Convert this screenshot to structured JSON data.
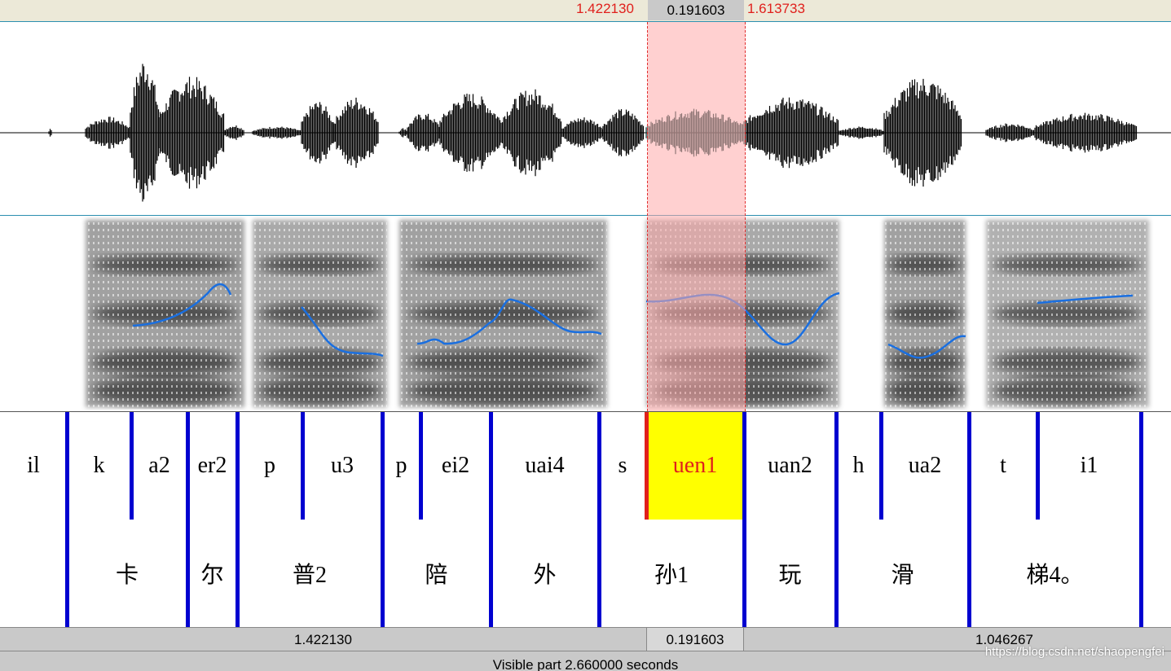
{
  "selection": {
    "start": "1.422130",
    "duration": "0.191603",
    "end": "1.613733"
  },
  "colors": {
    "selection_fill": "#ffaaaa",
    "selection_line": "#e03030",
    "boundary": "#0000d0",
    "pitch": "#1a6fe0",
    "selected_interval": "#ffff00"
  },
  "tier1": {
    "labels": [
      "il",
      "k",
      "a2",
      "er2",
      "p",
      "u3",
      "p",
      "ei2",
      "uai4",
      "s",
      "uen1",
      "uan2",
      "h",
      "ua2",
      "t",
      "i1"
    ],
    "selected_label": "uen1"
  },
  "tier2": {
    "labels": [
      "卡",
      "尔",
      "普2",
      "陪",
      "外",
      "孙1",
      "玩",
      "滑",
      "梯4。"
    ]
  },
  "footer": {
    "left": "1.422130",
    "middle": "0.191603",
    "right": "1.046267",
    "visible": "Visible part 2.660000 seconds"
  },
  "watermark": "https://blog.csdn.net/shaopengfei"
}
